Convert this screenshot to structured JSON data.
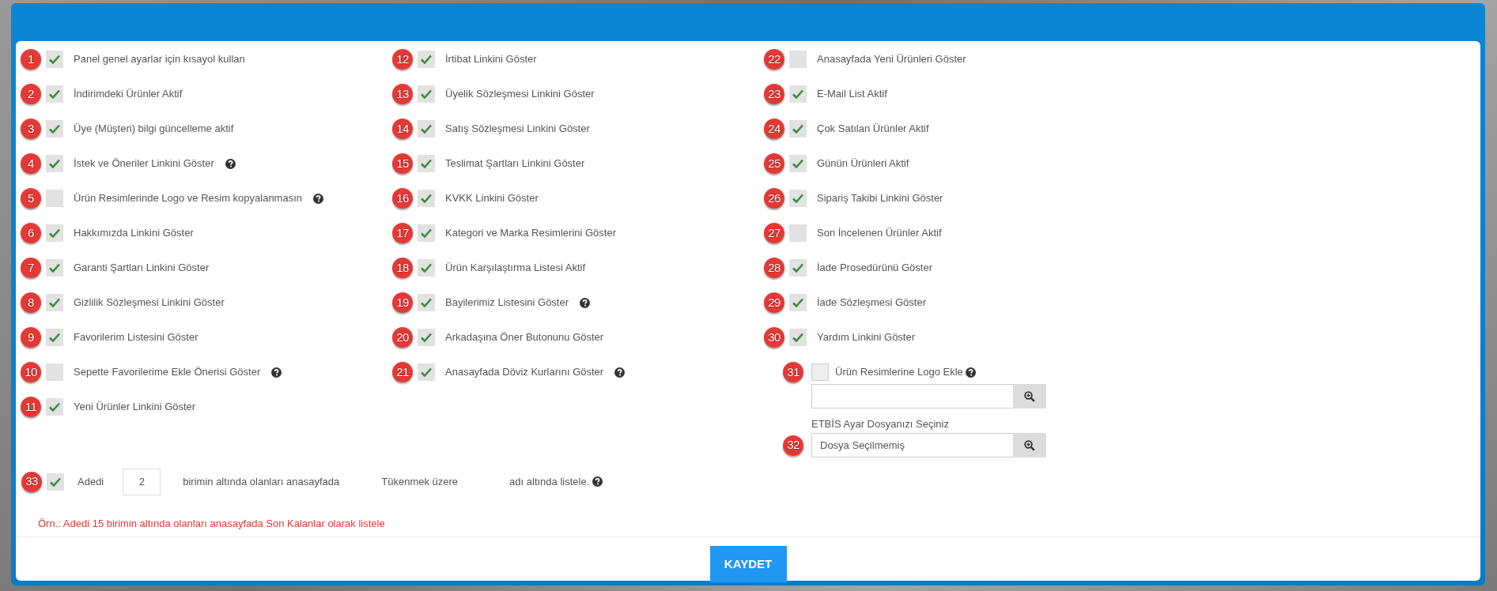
{
  "columns": [
    [
      {
        "number": "1",
        "label": "Panel genel ayarlar için kısayol kullan",
        "checked": true,
        "help": false
      },
      {
        "number": "2",
        "label": "İndirimdeki Ürünler Aktif",
        "checked": true,
        "help": false
      },
      {
        "number": "3",
        "label": "Üye (Müşteri) bilgi güncelleme aktif",
        "checked": true,
        "help": false
      },
      {
        "number": "4",
        "label": "İstek ve Öneriler Linkini Göster",
        "checked": true,
        "help": true
      },
      {
        "number": "5",
        "label": "Ürün Resimlerinde Logo ve Resim kopyalanmasın",
        "checked": false,
        "help": true
      },
      {
        "number": "6",
        "label": "Hakkımızda Linkini Göster",
        "checked": true,
        "help": false
      },
      {
        "number": "7",
        "label": "Garanti Şartları Linkini Göster",
        "checked": true,
        "help": false
      },
      {
        "number": "8",
        "label": "Gizlilik Sözleşmesi Linkini Göster",
        "checked": true,
        "help": false
      },
      {
        "number": "9",
        "label": "Favorilerim Listesini Göster",
        "checked": true,
        "help": false
      },
      {
        "number": "10",
        "label": "Sepette Favorilerime Ekle Önerisi Göster",
        "checked": false,
        "help": true
      },
      {
        "number": "11",
        "label": "Yeni Ürünler Linkini Göster",
        "checked": true,
        "help": false
      }
    ],
    [
      {
        "number": "12",
        "label": "İrtibat Linkini Göster",
        "checked": true,
        "help": false
      },
      {
        "number": "13",
        "label": "Üyelik Sözleşmesi Linkini Göster",
        "checked": true,
        "help": false
      },
      {
        "number": "14",
        "label": "Satış Sözleşmesi Linkini Göster",
        "checked": true,
        "help": false
      },
      {
        "number": "15",
        "label": "Teslimat Şartları Linkini Göster",
        "checked": true,
        "help": false
      },
      {
        "number": "16",
        "label": "KVKK Linkini Göster",
        "checked": true,
        "help": false
      },
      {
        "number": "17",
        "label": "Kategori ve Marka Resimlerini Göster",
        "checked": true,
        "help": false
      },
      {
        "number": "18",
        "label": "Ürün Karşılaştırma Listesi Aktif",
        "checked": true,
        "help": false
      },
      {
        "number": "19",
        "label": "Bayilerimiz Listesini Göster",
        "checked": true,
        "help": true
      },
      {
        "number": "20",
        "label": "Arkadaşına Öner Butonunu Göster",
        "checked": true,
        "help": false
      },
      {
        "number": "21",
        "label": "Anasayfada Döviz Kurlarını Göster",
        "checked": true,
        "help": true
      }
    ],
    [
      {
        "number": "22",
        "label": "Anasayfada Yeni Ürünleri Göster",
        "checked": false,
        "help": false
      },
      {
        "number": "23",
        "label": "E-Mail List Aktif",
        "checked": true,
        "help": false
      },
      {
        "number": "24",
        "label": "Çok Satılan Ürünler Aktif",
        "checked": true,
        "help": false
      },
      {
        "number": "25",
        "label": "Günün Ürünleri Aktif",
        "checked": true,
        "help": false
      },
      {
        "number": "26",
        "label": "Sipariş Takibi Linkini Göster",
        "checked": true,
        "help": false
      },
      {
        "number": "27",
        "label": "Son İncelenen Ürünler Aktif",
        "checked": false,
        "help": false
      },
      {
        "number": "28",
        "label": "İade Prosedürünü Göster",
        "checked": true,
        "help": false
      },
      {
        "number": "29",
        "label": "İade Sözleşmesi Göster",
        "checked": true,
        "help": false
      },
      {
        "number": "30",
        "label": "Yardım Linkini Göster",
        "checked": true,
        "help": false
      }
    ]
  ],
  "logo_option": {
    "number": "31",
    "label": "Ürün Resimlerine Logo Ekle",
    "checked": false,
    "help": true
  },
  "etbis": {
    "number": "32",
    "label": "ETBİS Ayar Dosyanızı Seçiniz",
    "value": "Dosya Seçilmemiş"
  },
  "low_stock": {
    "number": "33",
    "checked": true,
    "prefix": "Adedi",
    "quantity": "2",
    "middle": "birimin altında olanları anasayfada",
    "title_value": "Tükenmek üzere",
    "suffix": "adı altında listele.",
    "help": true
  },
  "example": "Örn.: Adedi 15 birimin altında olanları anasayfada Son Kalanlar olarak listele",
  "save_button": "KAYDET"
}
